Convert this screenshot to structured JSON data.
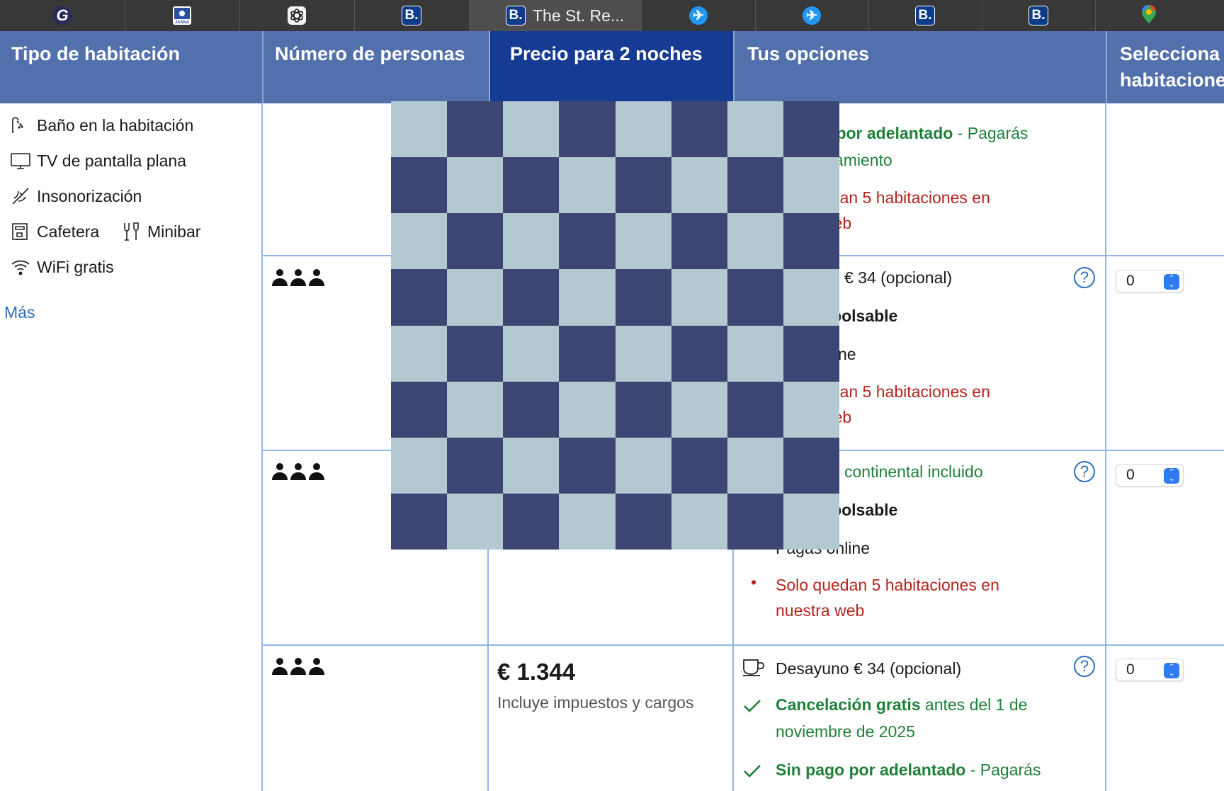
{
  "tabs": [
    {
      "icon": "grammarly-icon",
      "glyph": "G"
    },
    {
      "icon": "jasna-icon",
      "glyph": "JASNA"
    },
    {
      "icon": "openai-icon",
      "glyph": ""
    },
    {
      "icon": "booking-icon",
      "glyph": "B."
    },
    {
      "icon": "booking-icon",
      "glyph": "B.",
      "title": "The St. Re...",
      "active": true
    },
    {
      "icon": "plane-icon",
      "glyph": "✈"
    },
    {
      "icon": "plane-icon",
      "glyph": "✈"
    },
    {
      "icon": "booking-icon",
      "glyph": "B."
    },
    {
      "icon": "booking-icon",
      "glyph": "B."
    },
    {
      "icon": "maps-pin-icon",
      "glyph": ""
    }
  ],
  "header": {
    "room_type": "Tipo de habitación",
    "persons": "Número de personas",
    "price": "Precio para 2 noches",
    "options": "Tus opciones",
    "select_line1": "Selecciona",
    "select_line2": "habitaciones"
  },
  "facilities": [
    {
      "icon": "bathtub-icon",
      "label": "Baño en la habitación"
    },
    {
      "icon": "tv-icon",
      "label": "TV de pantalla plana"
    },
    {
      "icon": "soundproof-icon",
      "label": "Insonorización"
    },
    {
      "icon": "coffee-machine-icon",
      "label": "Cafetera"
    },
    {
      "icon": "minibar-icon",
      "label": "Minibar"
    },
    {
      "icon": "wifi-icon",
      "label": "WiFi gratis"
    }
  ],
  "more_link": "Más",
  "rows": [
    {
      "options": {
        "line1_bold": "o por adelantado",
        "line1_rest": " - Pagarás",
        "line2": "ojamiento",
        "scarcity1": "edan 5 habitaciones en",
        "scarcity2": "web"
      }
    },
    {
      "breakfast": "no € 34 (opcional)",
      "policy": "nbolsable",
      "payment": "nline",
      "scarcity1": "edan 5 habitaciones en",
      "scarcity2": "web",
      "qty": "0"
    },
    {
      "breakfast": "no continental incluido",
      "policy": "nbolsable",
      "payment": "Pagas online",
      "scarcity1": "Solo quedan 5 habitaciones en",
      "scarcity2": "nuestra web",
      "qty": "0"
    },
    {
      "price": "€ 1.344",
      "price_note": "Incluye impuestos y cargos",
      "breakfast": "Desayuno € 34 (opcional)",
      "cancel_bold": "Cancelación gratis",
      "cancel_rest": " antes del 1 de",
      "cancel_line2": "noviembre de 2025",
      "prepay_bold": "Sin pago por adelantado",
      "prepay_rest": " - Pagarás",
      "qty": "0"
    }
  ],
  "colors": {
    "header_bg": "#5270ab",
    "header_active": "#153b93",
    "grid_line": "#8fb6ea",
    "green": "#208039",
    "red": "#b3261e",
    "checker_dark": "#3d4572",
    "checker_light": "#b2c9d1"
  }
}
